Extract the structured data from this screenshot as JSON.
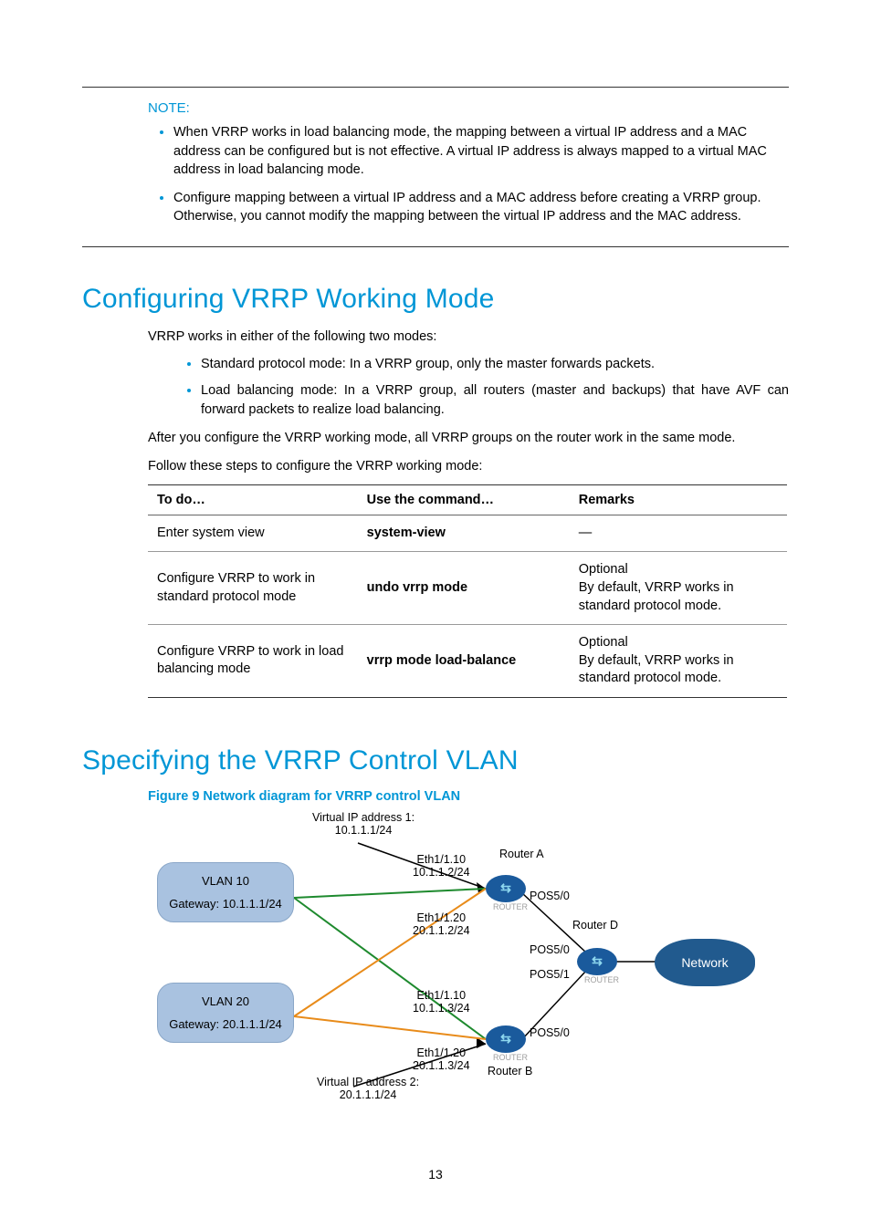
{
  "note": {
    "label": "NOTE:",
    "items": [
      "When VRRP works in load balancing mode, the mapping between a virtual IP address and a MAC address can be configured but is not effective. A virtual IP address is always mapped to a virtual MAC address in load balancing mode.",
      "Configure mapping between a virtual IP address and a MAC address before creating a VRRP group. Otherwise, you cannot modify the mapping between the virtual IP address and the MAC address."
    ]
  },
  "section1": {
    "heading": "Configuring VRRP Working Mode",
    "intro": "VRRP works in either of the following two modes:",
    "modes": [
      "Standard protocol mode: In a VRRP group, only the master forwards packets.",
      "Load balancing mode: In a VRRP group, all routers (master and backups) that have AVF can forward packets to realize load balancing."
    ],
    "after": "After you configure the VRRP working mode, all VRRP groups on the router work in the same mode.",
    "follow": "Follow these steps to configure the VRRP working mode:"
  },
  "table": {
    "head": {
      "c1": "To do…",
      "c2": "Use the command…",
      "c3": "Remarks"
    },
    "rows": [
      {
        "c1": "Enter system view",
        "c2": "system-view",
        "c3": "—"
      },
      {
        "c1": "Configure VRRP to work in standard protocol mode",
        "c2": "undo vrrp mode",
        "c3": "Optional\nBy default, VRRP works in standard protocol mode."
      },
      {
        "c1": "Configure VRRP to work in load balancing mode",
        "c2": "vrrp mode load-balance",
        "c3": "Optional\nBy default, VRRP works in standard protocol mode."
      }
    ]
  },
  "section2": {
    "heading": "Specifying the VRRP Control VLAN",
    "figcap": "Figure 9 Network diagram for VRRP control VLAN"
  },
  "diagram": {
    "vip1": "Virtual IP address 1:\n10.1.1.1/24",
    "vip2": "Virtual IP address 2:\n20.1.1.1/24",
    "vlan10": {
      "title": "VLAN 10",
      "gw": "Gateway: 10.1.1.1/24"
    },
    "vlan20": {
      "title": "VLAN 20",
      "gw": "Gateway: 20.1.1.1/24"
    },
    "ra": "Router A",
    "rb": "Router B",
    "rd": "Router D",
    "net": "Network",
    "e110a": "Eth1/1.10\n10.1.1.2/24",
    "e120a": "Eth1/1.20\n20.1.1.2/24",
    "e110b": "Eth1/1.10\n10.1.1.3/24",
    "e120b": "Eth1/1.20\n20.1.1.3/24",
    "pos50a": "POS5/0",
    "pos50d": "POS5/0",
    "pos51d": "POS5/1",
    "pos50b": "POS5/0",
    "routerlbl": "ROUTER"
  },
  "page": "13"
}
